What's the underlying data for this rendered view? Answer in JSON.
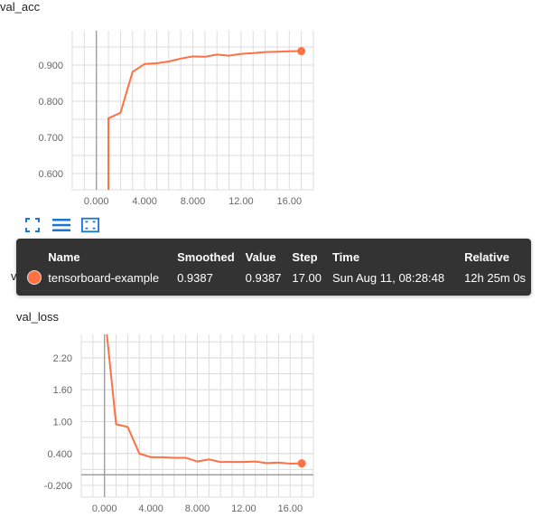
{
  "colors": {
    "line": "#ff7043",
    "grid": "#dddddd",
    "axis": "#999999",
    "tooltip_bg": "#333333"
  },
  "cards": [
    {
      "title": "val_acc"
    },
    {
      "title": "val_loss"
    }
  ],
  "toolbar": {
    "icons": [
      "expand-icon",
      "toggle-log-scale-icon",
      "fit-domain-icon"
    ]
  },
  "hidden_label": "val_l",
  "tooltip": {
    "headers": {
      "name": "Name",
      "smoothed": "Smoothed",
      "value": "Value",
      "step": "Step",
      "time": "Time",
      "relative": "Relative"
    },
    "row": {
      "name": "tensorboard-example",
      "smoothed": "0.9387",
      "value": "0.9387",
      "step": "17.00",
      "time": "Sun Aug 11, 08:28:48",
      "relative": "12h 25m 0s"
    }
  },
  "chart_data": [
    {
      "type": "line",
      "title": "val_acc",
      "xticks": [
        "0.000",
        "4.000",
        "8.000",
        "12.00",
        "16.00"
      ],
      "yticks": [
        "0.600",
        "0.700",
        "0.800",
        "0.900"
      ],
      "xlim": [
        -2.0,
        18.0
      ],
      "ylim": [
        0.555,
        0.995
      ],
      "grid": true,
      "series": [
        {
          "x": [
            1,
            1,
            2,
            3,
            4,
            5,
            6,
            7,
            8,
            9,
            10,
            11,
            12,
            13,
            14,
            15,
            16,
            17
          ],
          "y": [
            0.55,
            0.753,
            0.768,
            0.881,
            0.903,
            0.905,
            0.91,
            0.918,
            0.924,
            0.923,
            0.929,
            0.926,
            0.931,
            0.933,
            0.936,
            0.937,
            0.938,
            0.9387
          ]
        }
      ]
    },
    {
      "type": "line",
      "title": "val_loss",
      "xticks": [
        "0.000",
        "4.000",
        "8.000",
        "12.00",
        "16.00"
      ],
      "yticks": [
        "2.20",
        "1.60",
        "1.00",
        "0.400",
        "-0.200"
      ],
      "xlim": [
        -2.0,
        18.0
      ],
      "ylim": [
        -0.42,
        2.64
      ],
      "grid": true,
      "series": [
        {
          "x": [
            0.2,
            1,
            2,
            3,
            4,
            5,
            6,
            7,
            8,
            9,
            10,
            11,
            12,
            13,
            14,
            15,
            16,
            17
          ],
          "y": [
            2.65,
            0.95,
            0.9,
            0.4,
            0.33,
            0.33,
            0.32,
            0.32,
            0.25,
            0.29,
            0.24,
            0.24,
            0.24,
            0.25,
            0.22,
            0.23,
            0.21,
            0.215
          ]
        }
      ]
    }
  ]
}
